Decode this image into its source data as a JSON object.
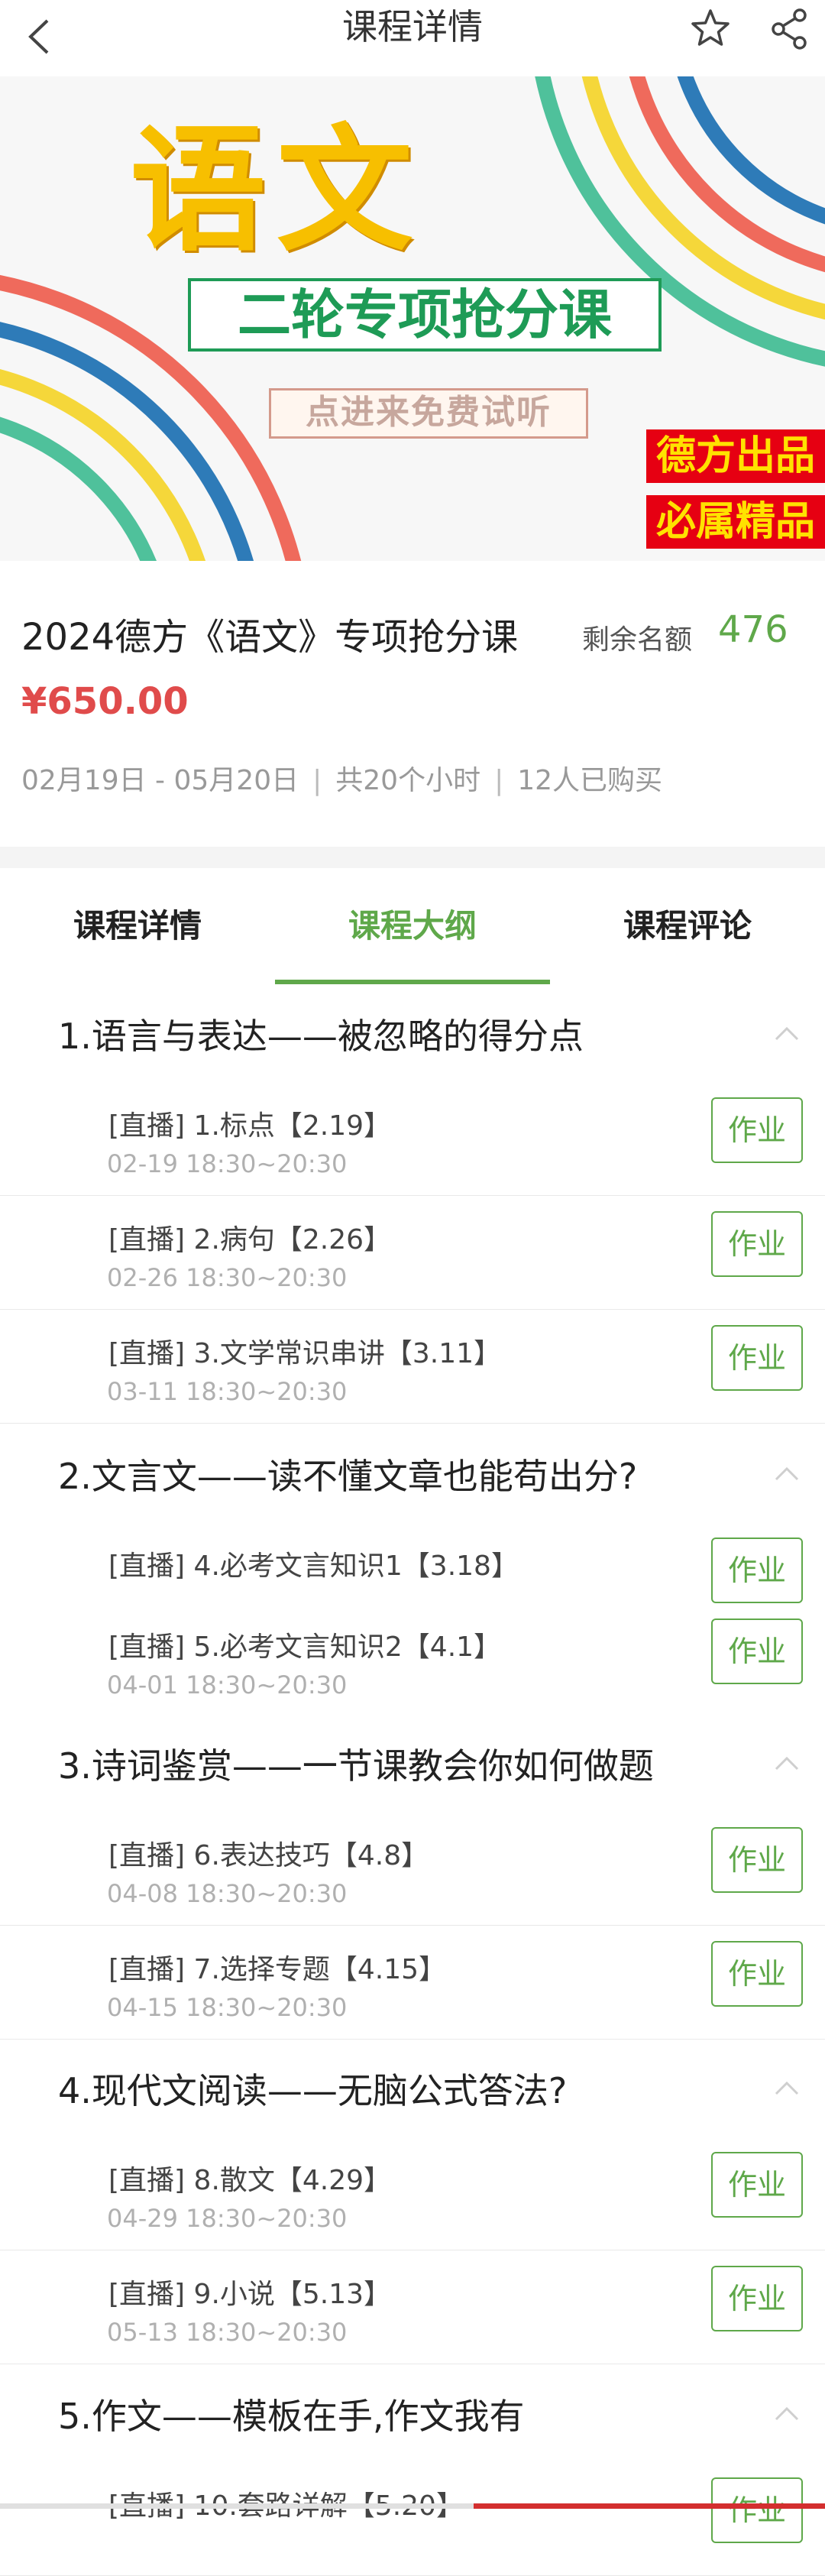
{
  "header": {
    "title": "课程详情"
  },
  "banner": {
    "main_text": "语文",
    "subtitle": "二轮专项抢分课",
    "trial_text": "点进来免费试听",
    "badge1": "德方出品",
    "badge2": "必属精品"
  },
  "course": {
    "name": "2024德方《语文》专项抢分课",
    "remain_label": "剩余名额",
    "remain_count": "476",
    "price": "¥650.00",
    "date_range": "02月19日 - 05月20日",
    "hours": "共20个小时",
    "buyers": "12人已购买"
  },
  "tabs": [
    "课程详情",
    "课程大纲",
    "课程评论"
  ],
  "active_tab": "课程大纲",
  "homework_label": "作业",
  "outline": [
    {
      "title": "1.语言与表达——被忽略的得分点",
      "lessons": [
        {
          "title": "[直播] 1.标点【2.19】",
          "time": "02-19 18:30~20:30"
        },
        {
          "title": "[直播] 2.病句【2.26】",
          "time": "02-26 18:30~20:30"
        },
        {
          "title": "[直播] 3.文学常识串讲【3.11】",
          "time": "03-11 18:30~20:30"
        }
      ]
    },
    {
      "title": "2.文言文——读不懂文章也能苟出分?",
      "lessons": [
        {
          "title": "[直播] 4.必考文言知识1【3.18】",
          "time": ""
        },
        {
          "title": "[直播] 5.必考文言知识2【4.1】",
          "time": "04-01 18:30~20:30"
        }
      ]
    },
    {
      "title": "3.诗词鉴赏——一节课教会你如何做题",
      "lessons": [
        {
          "title": "[直播] 6.表达技巧【4.8】",
          "time": "04-08 18:30~20:30"
        },
        {
          "title": "[直播] 7.选择专题【4.15】",
          "time": "04-15 18:30~20:30"
        }
      ]
    },
    {
      "title": "4.现代文阅读——无脑公式答法?",
      "lessons": [
        {
          "title": "[直播] 8.散文【4.29】",
          "time": "04-29 18:30~20:30"
        },
        {
          "title": "[直播] 9.小说【5.13】",
          "time": "05-13 18:30~20:30"
        }
      ]
    },
    {
      "title": "5.作文——模板在手,作文我有",
      "lessons": [
        {
          "title": "[直播] 10.套路详解【5.20】",
          "time": ""
        }
      ]
    }
  ],
  "colors": {
    "accent": "#5fa84a",
    "price": "#e04b4b",
    "banner_yellow": "#f7bf00",
    "banner_green": "#1e9b56",
    "badge_red": "#e60012"
  }
}
